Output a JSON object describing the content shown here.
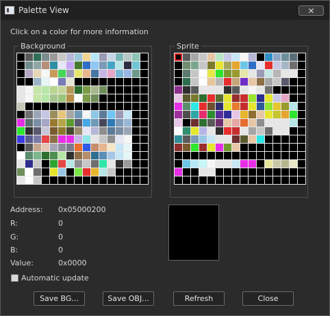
{
  "window": {
    "title": "Palette View",
    "close_glyph": "✕"
  },
  "instruction": "Click on a color for more information",
  "background_group": {
    "label": "Background"
  },
  "sprite_group": {
    "label": "Sprite"
  },
  "info": {
    "address_label": "Address:",
    "address_value": "0x05000200",
    "r_label": "R:",
    "r_value": "0",
    "g_label": "G:",
    "g_value": "0",
    "b_label": "B:",
    "b_value": "0",
    "value_label": "Value:",
    "value_value": "0x0000"
  },
  "preview_color": "#000000",
  "auto_update": {
    "label": "Automatic update",
    "checked": false
  },
  "buttons": {
    "save_bg": "Save BG...",
    "save_obj": "Save OBJ...",
    "refresh": "Refresh",
    "close": "Close"
  },
  "selected_swatch": {
    "palette": "sprite",
    "index": 0
  },
  "background_palette": [
    [
      "#000000",
      "#5a5a5a",
      "#2f6f56",
      "#7a8c8c",
      "#9a9a9a",
      "#c7c7c7",
      "#b6b6d6",
      "#9ac6d6",
      "#f1d694",
      "#b6e6f6",
      "#9a9ab6",
      "#c6d6e6",
      "#7ab6b6",
      "#b6c6c6",
      "#8ec6b6",
      "#000000"
    ],
    [
      "#000000",
      "#6f8c8c",
      "#8ea6a6",
      "#b68e7a",
      "#2e8ea6",
      "#e6e6f6",
      "#c6a6f6",
      "#467a2e",
      "#2e6ec6",
      "#8ec6f6",
      "#7a9ab6",
      "#46a6c6",
      "#b6e6e6",
      "#2e2e46",
      "#6ec6d6",
      "#000000"
    ],
    [
      "#000000",
      "#b6a6c6",
      "#e6d6b6",
      "#f6f6f6",
      "#c69a5a",
      "#46d65a",
      "#9a9ab6",
      "#e6e66e",
      "#e6b68e",
      "#4676a6",
      "#c6b6e6",
      "#e6a6c6",
      "#7ab6d6",
      "#9ab6e6",
      "#6e9a8e",
      "#000000"
    ],
    [
      "#000000",
      "#000000",
      "#9ab6c6",
      "#e6f6f6",
      "#ffffff",
      "#7a7ab6",
      "#e6e6d6",
      "#000000",
      "#000000",
      "#000000",
      "#000000",
      "#000000",
      "#000000",
      "#000000",
      "#000000",
      "#000000"
    ],
    [
      "#e6e6e6",
      "#f6f6f6",
      "#c6e6a6",
      "#b6e6a6",
      "#b6d68e",
      "#c6d69a",
      "#b69a5a",
      "#2e6e2e",
      "#7a9a46",
      "#a6b68e",
      "#6e8e5a",
      "#000000",
      "#000000",
      "#000000",
      "#000000",
      "#000000"
    ],
    [
      "#e6e6e6",
      "#f6f6f6",
      "#c6e6a6",
      "#b6e6a6",
      "#a6c68e",
      "#9ac67a",
      "#b68e46",
      "#ffffff",
      "#7a9a46",
      "#6e8e5a",
      "#000000",
      "#000000",
      "#000000",
      "#000000",
      "#000000",
      "#000000"
    ],
    [
      "#c6c6b6",
      "#000000",
      "#000000",
      "#000000",
      "#000000",
      "#000000",
      "#000000",
      "#000000",
      "#000000",
      "#000000",
      "#000000",
      "#000000",
      "#000000",
      "#000000",
      "#000000",
      "#000000"
    ],
    [
      "#000000",
      "#6e6e6e",
      "#9aa6b6",
      "#c6c6e6",
      "#9a8e5a",
      "#e6c67a",
      "#a6a6a6",
      "#6e9ab6",
      "#f6f6f6",
      "#8ec6e6",
      "#5a7a9a",
      "#6ec6f6",
      "#9a9ab6",
      "#c6e6f6",
      "#000000",
      "#000000"
    ],
    [
      "#e62ee6",
      "#5a6e6e",
      "#7a8ea6",
      "#a6a6c6",
      "#9a7a2e",
      "#b6a646",
      "#5a9a2e",
      "#5a5a6e",
      "#46a6e6",
      "#6e9ab6",
      "#46465a",
      "#2e7ab6",
      "#7a9ab6",
      "#9ab6d6",
      "#000000",
      "#000000"
    ],
    [
      "#2ee62e",
      "#2e2e2e",
      "#5a5a6e",
      "#c6c6d6",
      "#7a5a2e",
      "#8e7a2e",
      "#46462e",
      "#9a8e6e",
      "#e6e6f6",
      "#b6b6d6",
      "#8e8e8e",
      "#5a7a9a",
      "#7a8ea6",
      "#9aa6b6",
      "#000000",
      "#000000"
    ],
    [
      "#3a3ae6",
      "#5a5a8e",
      "#7a7aa6",
      "#e64646",
      "#8e6e46",
      "#e62ee6",
      "#e62ee6",
      "#c6b6e6",
      "#8ee6e6",
      "#e6e6e6",
      "#c6c6c6",
      "#8e8e8e",
      "#e6e6f6",
      "#f6f6f6",
      "#000000",
      "#000000"
    ],
    [
      "#000000",
      "#5a5a5a",
      "#c6a68e",
      "#e6c6b6",
      "#a6a6b6",
      "#8e8e9a",
      "#7a7a8e",
      "#e66e2e",
      "#2e5ae6",
      "#c68e6e",
      "#e6b68e",
      "#f6e6c6",
      "#c6e6f6",
      "#e6f6f6",
      "#000000",
      "#000000"
    ],
    [
      "#ffffff",
      "#5a8e6e",
      "#7ab68e",
      "#2e6e2e",
      "#4e8e4e",
      "#b6e6a6",
      "#2e2e2e",
      "#8e6e46",
      "#b68e6e",
      "#2e6e8e",
      "#5a8eb6",
      "#a6c6e6",
      "#c6e6f6",
      "#e6f6f6",
      "#000000",
      "#000000"
    ],
    [
      "#e6e6e6",
      "#2e2e8e",
      "#c6c6c6",
      "#000000",
      "#2ea62e",
      "#e64646",
      "#b6e6e6",
      "#8e8e8e",
      "#c6c6c6",
      "#6e6e6e",
      "#2ee6a6",
      "#e6e6e6",
      "#2e2e2e",
      "#9a9a9a",
      "#000000",
      "#000000"
    ],
    [
      "#6e8e5a",
      "#ffffff",
      "#6e6e6e",
      "#000000",
      "#e6e62e",
      "#9ac6e6",
      "#000000",
      "#7ae646",
      "#e62e2e",
      "#e6b62e",
      "#b6e6e6",
      "#c6c6c6",
      "#000000",
      "#000000",
      "#000000",
      "#000000"
    ],
    [
      "#e6e6e6",
      "#ffffff",
      "#c6c6c6",
      "#000000",
      "#000000",
      "#000000",
      "#000000",
      "#000000",
      "#000000",
      "#000000",
      "#000000",
      "#000000",
      "#000000",
      "#000000",
      "#000000",
      "#000000"
    ]
  ],
  "sprite_palette": [
    [
      "#000000",
      "#5a5a5a",
      "#a6a6a6",
      "#c6c6c6",
      "#e6c6a6",
      "#b6e6c6",
      "#c6c6e6",
      "#c6e6f6",
      "#f6f6f6",
      "#b6b6d6",
      "#000000",
      "#2e8ec6",
      "#8ea6c6",
      "#6e8e9a",
      "#5a6e7a",
      "#000000"
    ],
    [
      "#000000",
      "#6e8e6e",
      "#7aa68e",
      "#c6c6c6",
      "#7a7a2e",
      "#e6e62e",
      "#a6a65a",
      "#e6a62e",
      "#6ec6e6",
      "#2e6ec6",
      "#e6e6f6",
      "#e62e2e",
      "#c6c6e6",
      "#a6b6c6",
      "#6e6e6e",
      "#000000"
    ],
    [
      "#000000",
      "#5a7a6e",
      "#c6c6c6",
      "#ffffff",
      "#e6e646",
      "#2ee62e",
      "#7a9a2e",
      "#9a9a2e",
      "#e6e6a6",
      "#e6e6e6",
      "#9a9ab6",
      "#c6e6e6",
      "#b6b6b6",
      "#e6e6e6",
      "#e6e6e6",
      "#000000"
    ],
    [
      "#000000",
      "#2e6e4e",
      "#c6c6c6",
      "#ffffff",
      "#e6c69a",
      "#b6b6b6",
      "#e62e2e",
      "#c6a67a",
      "#6e2ec6",
      "#e6c6a6",
      "#8e6e46",
      "#a6a6a6",
      "#c6c6c6",
      "#5a5a6e",
      "#000000",
      "#000000"
    ],
    [
      "#8e2e8e",
      "#2e2e2e",
      "#5a5a5a",
      "#e6e6e6",
      "#e6e6e6",
      "#e6e6e6",
      "#2e2e2e",
      "#5a5a5a",
      "#e6e6e6",
      "#f6f6f6",
      "#e6e6e6",
      "#6e6e6e",
      "#000000",
      "#000000",
      "#000000",
      "#000000"
    ],
    [
      "#e6c6e6",
      "#5a5a2e",
      "#7a7a2e",
      "#2e6e2e",
      "#e62e2e",
      "#5a6e2e",
      "#e6e62e",
      "#9a2e2e",
      "#c62e2e",
      "#9ae62e",
      "#2e2e8e",
      "#e6e62e",
      "#c6c6e6",
      "#e6a6c6",
      "#000000",
      "#000000"
    ],
    [
      "#e62ee6",
      "#5a8e6e",
      "#2ee6e6",
      "#e62e2e",
      "#6e4e2e",
      "#2e2e6e",
      "#e6e62e",
      "#e67a2e",
      "#c62e2e",
      "#e6e62e",
      "#2e5a9a",
      "#8ee62e",
      "#e6c62e",
      "#9a9a2e",
      "#b6e6e6",
      "#000000"
    ],
    [
      "#9a2e9a",
      "#4e4e4e",
      "#2ea6a6",
      "#e62e6e",
      "#2e8e2e",
      "#5a2e9a",
      "#2e2e9a",
      "#e6c6e6",
      "#e6b62e",
      "#8e6e2e",
      "#e6c6a6",
      "#e6e62e",
      "#c6c62e",
      "#e6a62e",
      "#2ee62e",
      "#000000"
    ],
    [
      "#e6c6e6",
      "#000000",
      "#6e2e2e",
      "#2e6e2e",
      "#5a5a5a",
      "#6e2e6e",
      "#e6c6a6",
      "#e6a6a6",
      "#e66e2e",
      "#e6c6a6",
      "#8e8e8e",
      "#e6e6e6",
      "#e6e6e6",
      "#e6e6e6",
      "#b6e6e6",
      "#000000"
    ],
    [
      "#ffffff",
      "#2e8e6e",
      "#e6e62e",
      "#b6b6e6",
      "#e6e6e6",
      "#2e2e2e",
      "#e62e2e",
      "#c62e2e",
      "#e6e6e6",
      "#a6a6a6",
      "#c6c6c6",
      "#6e6e6e",
      "#e6e6e6",
      "#e6e6e6",
      "#000000",
      "#000000"
    ],
    [
      "#2e8e9a",
      "#5a5a5a",
      "#7a9ab6",
      "#9ac6e6",
      "#c6e6f6",
      "#e6e6e6",
      "#e6e6e6",
      "#6e2e2e",
      "#5a5a2e",
      "#e6c6a6",
      "#2ee6e6",
      "#000000",
      "#000000",
      "#000000",
      "#000000",
      "#000000"
    ],
    [
      "#8e2e2e",
      "#7a5a2e",
      "#2ee62e",
      "#9a2e2e",
      "#e6e62e",
      "#e62ee6",
      "#6e9a2e",
      "#e6c6a6",
      "#000000",
      "#000000",
      "#000000",
      "#000000",
      "#000000",
      "#000000",
      "#000000",
      "#000000"
    ],
    [
      "#000000",
      "#000000",
      "#000000",
      "#000000",
      "#000000",
      "#000000",
      "#000000",
      "#000000",
      "#000000",
      "#000000",
      "#000000",
      "#000000",
      "#000000",
      "#000000",
      "#000000",
      "#000000"
    ],
    [
      "#000000",
      "#6ec6e6",
      "#b6e6f6",
      "#c6f6f6",
      "#f6f6f6",
      "#e6e6e6",
      "#e6e6e6",
      "#c6e6f6",
      "#e62ee6",
      "#e62ee6",
      "#000000",
      "#e6e69a",
      "#c6c6a6",
      "#b6b68e",
      "#e6e6c6",
      "#000000"
    ],
    [
      "#e62ee6",
      "#000000",
      "#000000",
      "#e6e6e6",
      "#e6e6e6",
      "#000000",
      "#000000",
      "#000000",
      "#000000",
      "#000000",
      "#000000",
      "#000000",
      "#000000",
      "#000000",
      "#000000",
      "#000000"
    ],
    [
      "#000000",
      "#000000",
      "#000000",
      "#000000",
      "#000000",
      "#000000",
      "#000000",
      "#000000",
      "#000000",
      "#000000",
      "#000000",
      "#000000",
      "#000000",
      "#000000",
      "#000000",
      "#000000"
    ]
  ]
}
